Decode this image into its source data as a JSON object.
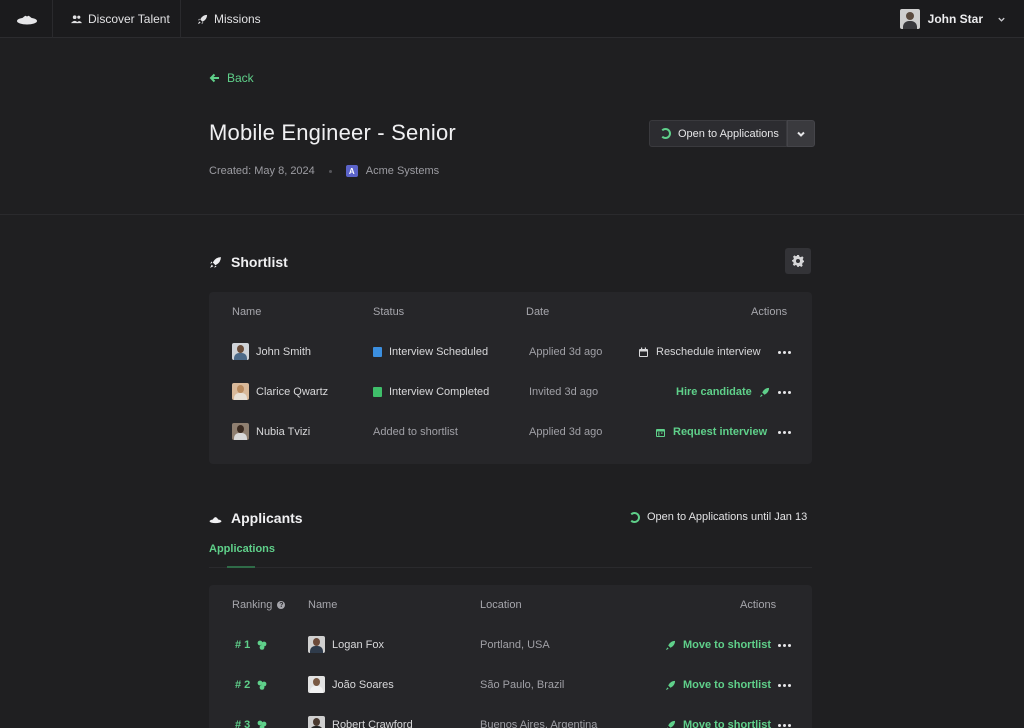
{
  "nav": {
    "discover_label": "Discover Talent",
    "missions_label": "Missions",
    "user_name": "John Star"
  },
  "header": {
    "back_label": "Back",
    "title": "Mobile Engineer - Senior",
    "created": "Created: May 8, 2024",
    "company_initial": "A",
    "company": "Acme Systems",
    "status_label": "Open to Applications"
  },
  "shortlist": {
    "title": "Shortlist",
    "columns": [
      "Name",
      "Status",
      "Date",
      "Actions"
    ],
    "rows": [
      {
        "name": "John Smith",
        "status": "Interview Scheduled",
        "date": "Applied 3d ago",
        "action": "Reschedule interview"
      },
      {
        "name": "Clarice Qwartz",
        "status": "Interview Completed",
        "date": "Invited 3d ago",
        "action": "Hire candidate"
      },
      {
        "name": "Nubia Tvizi",
        "status": "Added to shortlist",
        "date": "Applied 3d ago",
        "action": "Request interview"
      }
    ]
  },
  "applicants": {
    "title": "Applicants",
    "open_until": "Open to Applications until Jan 13",
    "tab": "Applications",
    "columns": [
      "Ranking",
      "Name",
      "Location",
      "Actions"
    ],
    "rows": [
      {
        "rank": "# 1",
        "name": "Logan Fox",
        "location": "Portland, USA",
        "action": "Move to shortlist"
      },
      {
        "rank": "# 2",
        "name": "João Soares",
        "location": "São Paulo, Brazil",
        "action": "Move to shortlist"
      },
      {
        "rank": "# 3",
        "name": "Robert Crawford",
        "location": "Buenos Aires, Argentina",
        "action": "Move to shortlist"
      }
    ]
  },
  "colors": {
    "accent": "#5fd08a",
    "background": "#1f1f21",
    "card": "#262629"
  },
  "icons": [
    "logo-icon",
    "people-icon",
    "rocket-icon",
    "arrow-left-icon",
    "spinner-icon",
    "chevron-down-icon",
    "gear-icon",
    "calendar-icon",
    "dots-icon",
    "hat-icon",
    "badge-icon",
    "info-icon"
  ]
}
